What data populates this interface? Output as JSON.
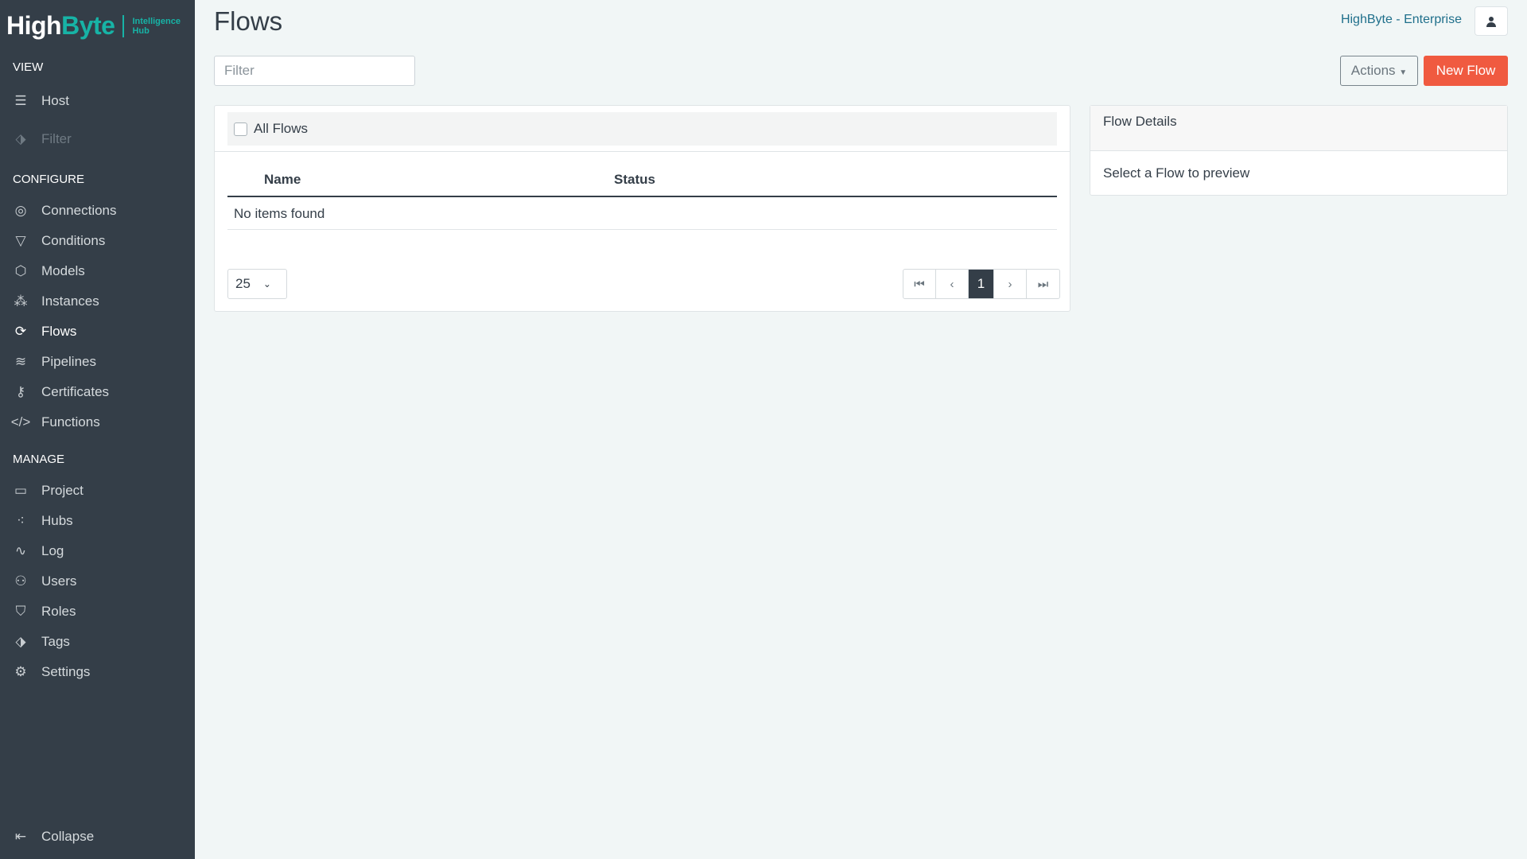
{
  "brand": {
    "name_part1": "High",
    "name_part2": "Byte",
    "subtitle_line1": "Intelligence",
    "subtitle_line2": "Hub"
  },
  "sidebar": {
    "view_heading": "VIEW",
    "view_items": [
      {
        "label": "Host",
        "icon": "server-icon"
      },
      {
        "label": "Filter",
        "icon": "tag-icon"
      }
    ],
    "configure_heading": "CONFIGURE",
    "configure_items": [
      {
        "label": "Connections",
        "icon": "plug-icon"
      },
      {
        "label": "Conditions",
        "icon": "funnel-icon"
      },
      {
        "label": "Models",
        "icon": "cube-icon"
      },
      {
        "label": "Instances",
        "icon": "cubes-icon"
      },
      {
        "label": "Flows",
        "icon": "sync-icon",
        "active": true
      },
      {
        "label": "Pipelines",
        "icon": "layers-icon"
      },
      {
        "label": "Certificates",
        "icon": "key-icon"
      },
      {
        "label": "Functions",
        "icon": "code-icon"
      }
    ],
    "manage_heading": "MANAGE",
    "manage_items": [
      {
        "label": "Project",
        "icon": "archive-icon"
      },
      {
        "label": "Hubs",
        "icon": "hierarchy-icon"
      },
      {
        "label": "Log",
        "icon": "pulse-icon"
      },
      {
        "label": "Users",
        "icon": "users-icon"
      },
      {
        "label": "Roles",
        "icon": "shield-icon"
      },
      {
        "label": "Tags",
        "icon": "tags-icon"
      },
      {
        "label": "Settings",
        "icon": "gear-icon"
      }
    ],
    "collapse": "Collapse"
  },
  "header": {
    "title": "Flows",
    "account": "HighByte - Enterprise",
    "filter_placeholder": "Filter",
    "actions_label": "Actions",
    "new_flow_label": "New Flow"
  },
  "table": {
    "all_flows_label": "All Flows",
    "columns": [
      "Name",
      "Status"
    ],
    "empty_text": "No items found",
    "page_size": "25",
    "current_page": "1"
  },
  "details": {
    "title": "Flow Details",
    "empty_text": "Select a Flow to preview"
  },
  "colors": {
    "sidebar": "#343e48",
    "accent": "#17b3a6",
    "primary": "#f05a40",
    "background": "#f1f6f6"
  }
}
